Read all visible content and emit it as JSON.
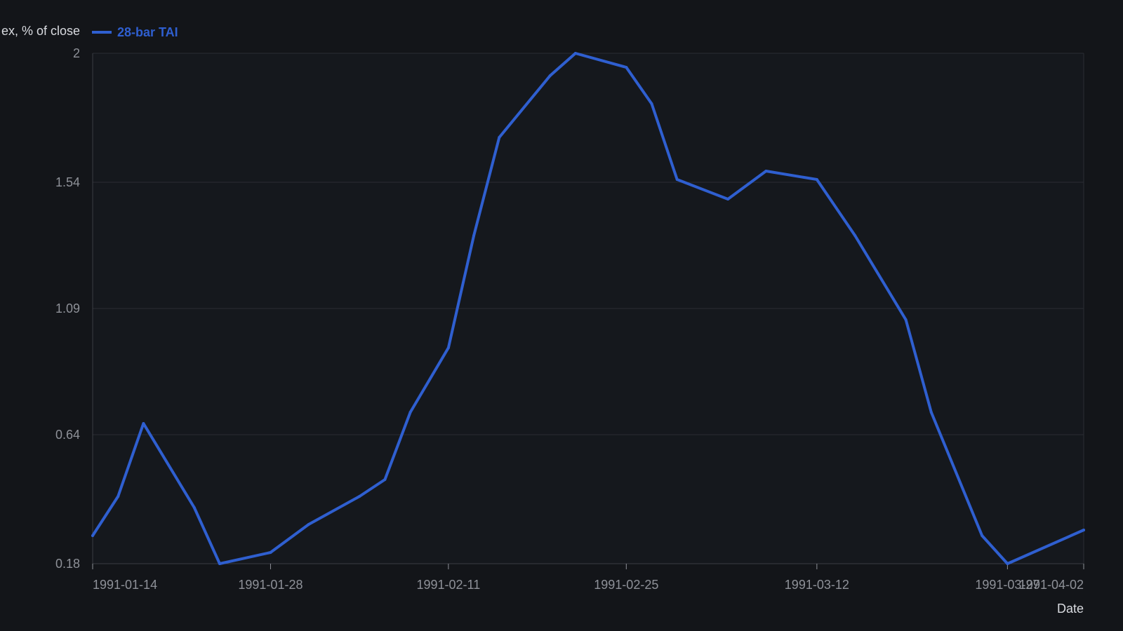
{
  "chart_data": {
    "type": "line",
    "title": "",
    "xlabel": "Date",
    "ylabel": "Trend Activity Index, % of close",
    "ylabel_visible": "ex, % of close",
    "y_ticks": [
      "0.18",
      "0.64",
      "1.09",
      "1.54",
      "2"
    ],
    "ylim": [
      0.18,
      2
    ],
    "x_ticks": [
      {
        "date": "1991-01-14",
        "label": "1991-01-14"
      },
      {
        "date": "1991-01-28",
        "label": "1991-01-28"
      },
      {
        "date": "1991-02-11",
        "label": "1991-02-11"
      },
      {
        "date": "1991-02-25",
        "label": "1991-02-25"
      },
      {
        "date": "1991-03-12",
        "label": "1991-03-12"
      },
      {
        "date": "1991-03-27",
        "label": "1991-03-27"
      },
      {
        "date": "1991-04-02",
        "label": "1991-04-02"
      }
    ],
    "xlim": [
      "1991-01-14",
      "1991-04-02"
    ],
    "grid": true,
    "legend_position": "top-left",
    "colors": {
      "background": "#131519",
      "grid": "#2a2d33",
      "axis": "#3a3d44",
      "series": "#2f5fd0",
      "tick_text": "#8e9198",
      "title_text": "#d9dbe0"
    },
    "series": [
      {
        "name": "28-bar TAI",
        "color": "#2f5fd0",
        "points": [
          {
            "x": "1991-01-14",
            "y": 0.28
          },
          {
            "x": "1991-01-16",
            "y": 0.42
          },
          {
            "x": "1991-01-18",
            "y": 0.68
          },
          {
            "x": "1991-01-22",
            "y": 0.38
          },
          {
            "x": "1991-01-24",
            "y": 0.18
          },
          {
            "x": "1991-01-28",
            "y": 0.22
          },
          {
            "x": "1991-01-31",
            "y": 0.32
          },
          {
            "x": "1991-02-04",
            "y": 0.42
          },
          {
            "x": "1991-02-06",
            "y": 0.48
          },
          {
            "x": "1991-02-08",
            "y": 0.72
          },
          {
            "x": "1991-02-11",
            "y": 0.95
          },
          {
            "x": "1991-02-13",
            "y": 1.35
          },
          {
            "x": "1991-02-15",
            "y": 1.7
          },
          {
            "x": "1991-02-19",
            "y": 1.92
          },
          {
            "x": "1991-02-21",
            "y": 2.0
          },
          {
            "x": "1991-02-25",
            "y": 1.95
          },
          {
            "x": "1991-02-27",
            "y": 1.82
          },
          {
            "x": "1991-03-01",
            "y": 1.55
          },
          {
            "x": "1991-03-05",
            "y": 1.48
          },
          {
            "x": "1991-03-08",
            "y": 1.58
          },
          {
            "x": "1991-03-12",
            "y": 1.55
          },
          {
            "x": "1991-03-15",
            "y": 1.35
          },
          {
            "x": "1991-03-19",
            "y": 1.05
          },
          {
            "x": "1991-03-21",
            "y": 0.72
          },
          {
            "x": "1991-03-25",
            "y": 0.28
          },
          {
            "x": "1991-03-27",
            "y": 0.18
          },
          {
            "x": "1991-04-02",
            "y": 0.3
          }
        ]
      }
    ]
  }
}
